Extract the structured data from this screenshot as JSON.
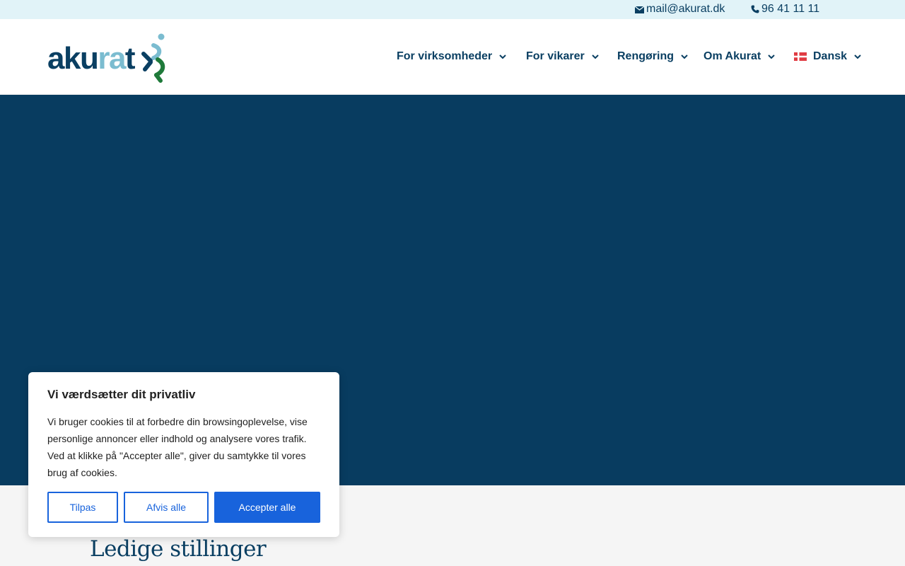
{
  "topbar": {
    "email": "mail@akurat.dk",
    "phone": "96 41 11 11",
    "email_icon": "envelope-icon",
    "phone_icon": "phone-icon"
  },
  "brand": {
    "logo_text": "akurat",
    "colors": {
      "navy": "#0a3f62",
      "light_blue": "#7bbcd0",
      "green": "#1f7a3a"
    }
  },
  "nav": {
    "items": [
      {
        "label": "For virksomheder"
      },
      {
        "label": "For vikarer"
      },
      {
        "label": "Rengøring"
      },
      {
        "label": "Om Akurat"
      },
      {
        "label": "Dansk",
        "icon": "danish-flag-icon"
      }
    ]
  },
  "hero": {
    "background": "#083c60"
  },
  "main": {
    "section_title": "Ledige stillinger"
  },
  "cookie": {
    "title": "Vi værdsætter dit privatliv",
    "body": "Vi bruger cookies til at forbedre din browsingoplevelse, vise personlige annoncer eller indhold og analysere vores trafik. Ved at klikke på \"Accepter alle\", giver du samtykke til vores brug af cookies.",
    "customize_label": "Tilpas",
    "reject_label": "Afvis alle",
    "accept_label": "Accepter alle",
    "accent": "#1863dc"
  }
}
